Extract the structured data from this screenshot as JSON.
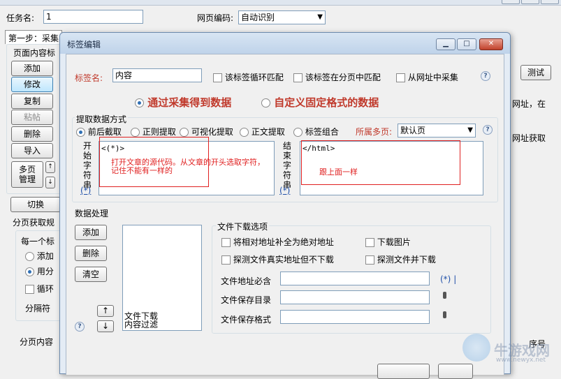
{
  "background": {
    "task_name_label": "任务名:",
    "task_name_value": "1",
    "encoding_label": "网页编码:",
    "encoding_value": "自动识别",
    "step_tab": "第一步：采集",
    "page_content_label": "页面内容标",
    "buttons": [
      "添加",
      "修改",
      "复制",
      "粘帖",
      "删除",
      "导入"
    ],
    "multipage_button": "多页\n管理",
    "switch_button": "切换",
    "pagination_rules_label": "分页获取规",
    "each_label": "每一个标",
    "option_add": "添加",
    "option_use": "用分",
    "option_loop": "循环",
    "separator_label": "分隔符",
    "pagination_content_label": "分页内容",
    "right_test_button": "测试",
    "right_text_1": "网址，在",
    "right_text_2": "网址获取",
    "right_seq_label": "序号"
  },
  "dialog": {
    "title": "标签编辑",
    "tag_name_label": "标签名:",
    "tag_name_value": "内容",
    "chk_loop": "该标签循环匹配",
    "chk_paged": "该标签在分页中匹配",
    "chk_from_url": "从网址中采集",
    "radio_collect": "通过采集得到数据",
    "radio_custom": "自定义固定格式的数据",
    "extract_group_label": "提取数据方式",
    "extract_options": [
      "前后截取",
      "正则提取",
      "可视化提取",
      "正文提取",
      "标签组合"
    ],
    "multipage_label": "所属多页:",
    "multipage_value": "默认页",
    "start_label": "开始字符串",
    "start_value": "<(*)>",
    "start_note": "打开文章的源代码。从文章的开头选取字符，记住不能有一样的",
    "end_label": "结束字符串",
    "end_value": "</html>",
    "end_note": "跟上面一样",
    "star_link": "(*)",
    "data_processing_label": "数据处理",
    "dp_buttons": [
      "添加",
      "删除",
      "清空"
    ],
    "dp_list": [
      "文件下载",
      "内容过滤"
    ],
    "file_download_label": "文件下载选项",
    "fd_chk_abs": "将相对地址补全为绝对地址",
    "fd_chk_images": "下载图片",
    "fd_chk_detect": "探测文件真实地址但不下载",
    "fd_chk_detect_dl": "探测文件并下载",
    "fd_addr_label": "文件地址必含",
    "fd_dir_label": "文件保存目录",
    "fd_fmt_label": "文件保存格式",
    "fd_star": "(*)"
  },
  "watermark": {
    "brand": "牛游戏网",
    "url": "www.newyx.net"
  },
  "colors": {
    "accent_red": "#c0392b",
    "annotation_red": "#e02020",
    "link_blue": "#1f4fa8",
    "title_bar": "#bfd3ea"
  }
}
